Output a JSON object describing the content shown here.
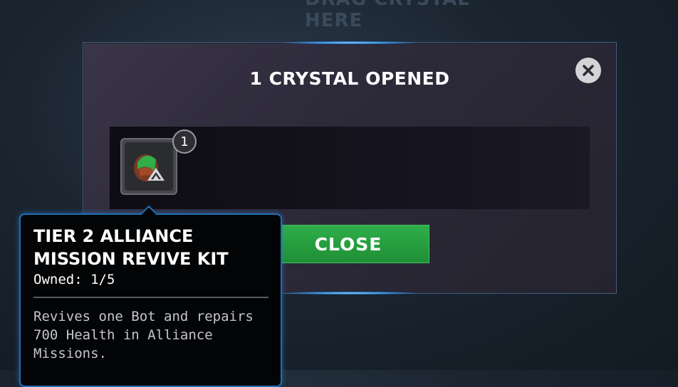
{
  "background": {
    "header_text": "DRAG CRYSTAL HERE"
  },
  "modal": {
    "title": "1 CRYSTAL OPENED",
    "close_icon": "close-x-icon",
    "close_button_label": "CLOSE",
    "rewards": [
      {
        "icon": "revive-kit-icon",
        "count": "1"
      }
    ]
  },
  "tooltip": {
    "name": "TIER 2 ALLIANCE MISSION REVIVE KIT",
    "owned": "Owned: 1/5",
    "description": "Revives one Bot and repairs 700 Health in Alliance Missions."
  },
  "colors": {
    "close_button": "#1f8f35",
    "tooltip_border": "#1f6fb5",
    "modal_glow": "#2f8de0"
  }
}
